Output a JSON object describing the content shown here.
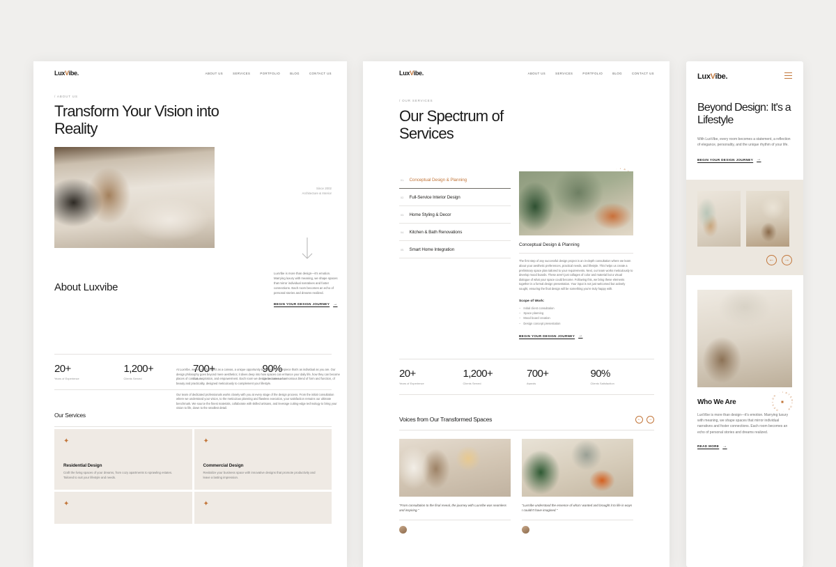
{
  "brand": {
    "name_pre": "Lux",
    "name_v": "V",
    "name_post": "ibe."
  },
  "nav": {
    "items": [
      "ABOUT US",
      "SERVICES",
      "PORTFOLIO",
      "BLOG",
      "CONTACT US"
    ]
  },
  "colors": {
    "accent": "#c2763a",
    "ink": "#1b1b1b",
    "muted": "#7d7d7d",
    "card_bg": "#efeae4",
    "page_bg": "#f0efed"
  },
  "panel_about": {
    "eyebrow": "/ ABOUT US",
    "title": "Transform Your Vision into Reality",
    "since_line1": "Since 2002",
    "since_line2": "Architecture & Interior",
    "scroll_icon": "down-arrow-icon",
    "hero_image_alt": "warm minimalist living room with arched wooden door",
    "intro": "LuxVibe is more than design—it's emotion. Marrying luxury with meaning, we shape spaces that mirror individual narratives and foster connections. Each room becomes an echo of personal stories and dreams realized.",
    "cta": "BEGIN YOUR DESIGN JOURNEY",
    "about_heading": "About Luxvibe",
    "about_p1": "At LuxVibe, we see each project as a canvas, a unique opportunity to create a masterpiece that's as individual as you are. Our design philosophy goes beyond mere aesthetics; it dives deep into how spaces can enhance your daily life, how they can become places of comfort, inspiration, and empowerment. Each room we design becomes a harmonious blend of form and function, of beauty and practicality, designed meticulously to complement your lifestyle.",
    "about_p2": "Our team of dedicated professionals works closely with you at every stage of the design process. From the initial consultation where we understand your vision, to the meticulous planning and flawless execution, your satisfaction remains our ultimate benchmark. We source the finest materials, collaborate with skilled artisans, and leverage cutting-edge technology to bring your vision to life, down to the smallest detail.",
    "stats": [
      {
        "num": "20+",
        "label": "Years of Experience"
      },
      {
        "num": "1,200+",
        "label": "Clients Served"
      },
      {
        "num": "700+",
        "label": "Awards"
      },
      {
        "num": "90%",
        "label": "Clients Satisfaction"
      }
    ],
    "services_heading": "Our Services",
    "cards": [
      {
        "icon": "sparkle-icon",
        "title": "Residential Design",
        "desc": "Craft the living spaces of your dreams, from cozy apartments to sprawling estates. Tailored to suit your lifestyle and needs."
      },
      {
        "icon": "sparkle-icon",
        "title": "Commercial Design",
        "desc": "Revitalize your business space with innovative designs that promote productivity and leave a lasting impression."
      },
      {
        "icon": "sparkle-icon",
        "title": "",
        "desc": ""
      },
      {
        "icon": "sparkle-icon",
        "title": "",
        "desc": ""
      }
    ]
  },
  "panel_services": {
    "eyebrow": "/ OUR SERVICES",
    "title": "Our Spectrum of Services",
    "stamp_text": "INTERIOR · DESIGN ·",
    "list": [
      {
        "index": "01.",
        "name": "Conceptual Design & Planning",
        "active": true
      },
      {
        "index": "02.",
        "name": "Full-Service Interior Design",
        "active": false
      },
      {
        "index": "03.",
        "name": "Home Styling & Decor",
        "active": false
      },
      {
        "index": "04.",
        "name": "Kitchen & Bath Renovations",
        "active": false
      },
      {
        "index": "05.",
        "name": "Smart Home Integration",
        "active": false
      }
    ],
    "detail": {
      "image_alt": "green wall console with round mirror and plants",
      "title": "Conceptual Design & Planning",
      "body": "The first step of any successful design project is an in-depth consultation where we learn about your aesthetic preferences, practical needs, and lifestyle. This helps us create a preliminary space plan tailored to your requirements. Next, our team works meticulously to develop mood boards. These aren't just collages of color and material but a visual dialogue of what your space could become. Following this, we bring these elements together in a formal design presentation. Your input is not just welcomed but actively sought, ensuring the final design will be something you're truly happy with.",
      "scope_title": "Scope of Work:",
      "scope": [
        "Initial client consultation",
        "Space planning",
        "Mood board creation",
        "Design concept presentation"
      ],
      "cta": "BEGIN YOUR DESIGN JOURNEY"
    },
    "stats": [
      {
        "num": "20+",
        "label": "Years of Experience"
      },
      {
        "num": "1,200+",
        "label": "Clients Served"
      },
      {
        "num": "700+",
        "label": "Awards"
      },
      {
        "num": "90%",
        "label": "Clients Satisfaction"
      }
    ],
    "testimonials_heading": "Voices from Our Transformed Spaces",
    "carousel_prev_icon": "arrow-left-icon",
    "carousel_next_icon": "arrow-right-icon",
    "testimonials": [
      {
        "image_alt": "neutral dining and living area with arches",
        "quote": "\"From consultation to the final reveal, the journey with LuxVibe was seamless and inspiring.\""
      },
      {
        "image_alt": "green plants with orange armchair and credenza",
        "quote": "\"LuxVibe understood the essence of what I wanted and brought it to life in ways I couldn't have imagined.\""
      }
    ]
  },
  "panel_mobile": {
    "menu_icon": "hamburger-menu-icon",
    "title": "Beyond Design: It's a Lifestyle",
    "body": "With LuxVibe, every room becomes a statement, a reflection of elegance, personality, and the unique rhythm of your life.",
    "cta": "BEGIN YOUR DESIGN JOURNEY",
    "carousel": {
      "images": [
        {
          "alt": "pampas grass beside armchair, sage arch wall"
        },
        {
          "alt": "beige sofa with wooden side tables near window"
        }
      ],
      "prev_icon": "arrow-left-icon",
      "next_icon": "arrow-right-icon"
    },
    "feature_image_alt": "dining room with pendant lights and rattan chairs",
    "who_heading": "Who We Are",
    "who_body": "LuxVibe is more than design—it's emotion. Marrying luxury with meaning, we shape spaces that mirror individual narratives and foster connections. Each room becomes an echo of personal stories and dreams realized.",
    "read_more": "READ MORE"
  }
}
